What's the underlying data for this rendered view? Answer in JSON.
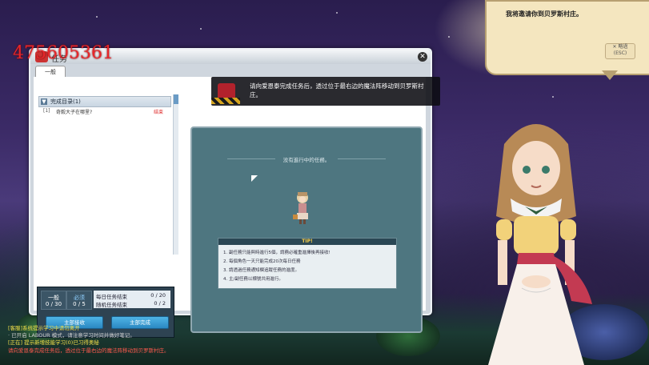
{
  "watermark": "475605361",
  "window": {
    "title": "任务",
    "tab": "一般",
    "category": {
      "toggle": "▼",
      "label": "完成目录(1)"
    },
    "quest": {
      "num": "[1]",
      "name": "奇毅大子在哪里?",
      "status": "结束"
    },
    "stats": {
      "general_label": "一般",
      "general_value": "0 / 30",
      "required_label": "必须",
      "required_value": "0 / 5",
      "daily_label": "每日任务结束",
      "daily_value": "0 / 20",
      "random_label": "随机任务结束",
      "random_value": "0 / 2"
    },
    "buttons": {
      "accept": "主部接收",
      "complete": "主部完成"
    },
    "content": {
      "no_quest": "没有進行中的任務。",
      "tip_title": "TIP!",
      "tips": [
        "1. 副任務只能與時進行5個，請務必確重進擇後再接收!",
        "2. 每個角色一天只能完成20次每日任務",
        "3. 請透過任務通知欄追蹤任務的進度。",
        "4. 主/副任務以標號共用進行。"
      ]
    }
  },
  "notice": {
    "text": "请向爱恩泰完成任务后，透过位于最右边的魔法阵移动到贝罗斯村庄。"
  },
  "dialog": {
    "text": "我将邀请你到贝罗斯村庄。",
    "skip_line1": "✕ 略過",
    "skip_line2": "(ESC)"
  },
  "chat": {
    "lines": [
      {
        "text": "[客服]系统提示学习中请勿离开",
        "color": "#f4e04a"
      },
      {
        "text": "· 已开启 LABOUR 模式，请注意学习时间并做好笔记。",
        "color": "#cfcfcf"
      },
      {
        "text": "[正在]  提示新增技能学习(0)已习得奥秘",
        "color": "#f4e04a"
      },
      {
        "text": "请向爱恩泰完成任务后，透过位于最右边的魔法阵移动到贝罗斯村庄。",
        "color": "#ff5a4e"
      }
    ]
  },
  "colors": {
    "accent": "#2a88c2",
    "status_red": "#d22222",
    "tip_title": "#ffd34a"
  }
}
